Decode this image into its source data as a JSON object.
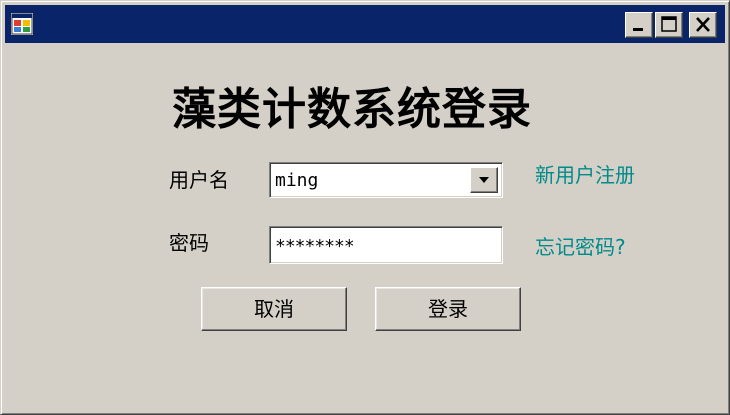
{
  "window": {
    "title_bar_color": "#0a246a",
    "icon": "app-window-icon",
    "controls": {
      "minimize_icon": "minimize-icon",
      "maximize_icon": "maximize-icon",
      "close_icon": "close-icon"
    }
  },
  "form": {
    "title": "藻类计数系统登录",
    "username": {
      "label": "用户名",
      "value": "ming",
      "dropdown_icon": "chevron-down-icon"
    },
    "password": {
      "label": "密码",
      "value": "********"
    },
    "links": {
      "register": "新用户注册",
      "forgot": "忘记密码?"
    },
    "buttons": {
      "cancel": "取消",
      "login": "登录"
    },
    "colors": {
      "background": "#d4d0c8",
      "link": "#008b8b"
    }
  }
}
